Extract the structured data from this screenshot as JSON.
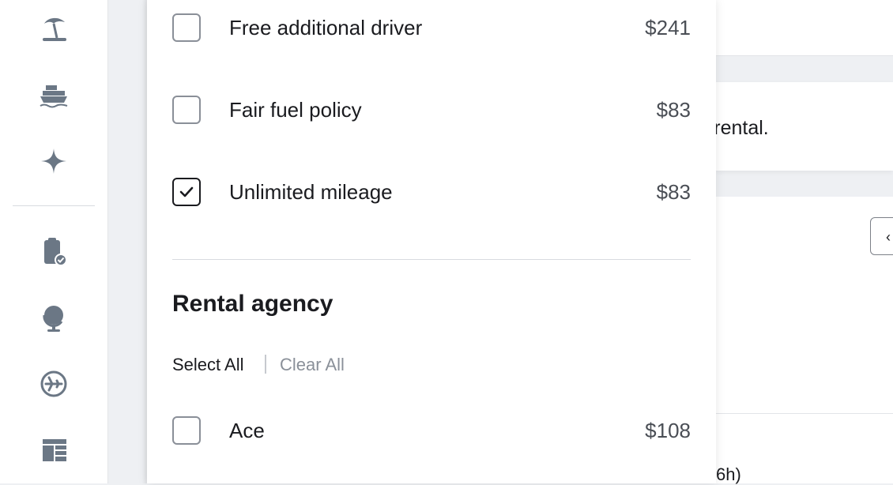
{
  "rail": {
    "icons": [
      "beach-umbrella-icon",
      "cruise-ship-icon",
      "sparkle-icon",
      "clipboard-check-icon",
      "globe-icon",
      "flight-status-icon",
      "layout-icon"
    ]
  },
  "filters": {
    "options": [
      {
        "label": "Free additional driver",
        "price": "$241",
        "checked": false
      },
      {
        "label": "Fair fuel policy",
        "price": "$83",
        "checked": false
      },
      {
        "label": "Unlimited mileage",
        "price": "$83",
        "checked": true
      }
    ],
    "agency": {
      "title": "Rental agency",
      "select_all": "Select All",
      "clear_all": "Clear All",
      "items": [
        {
          "label": "Ace",
          "price": "$108",
          "checked": false
        }
      ]
    }
  },
  "background": {
    "banner_text": "r rental.",
    "footer_text": "6h)",
    "button_glyph": "‹"
  },
  "colors": {
    "accent": "#1a1b1f",
    "muted": "#8a9099",
    "icon": "#6b7785"
  }
}
